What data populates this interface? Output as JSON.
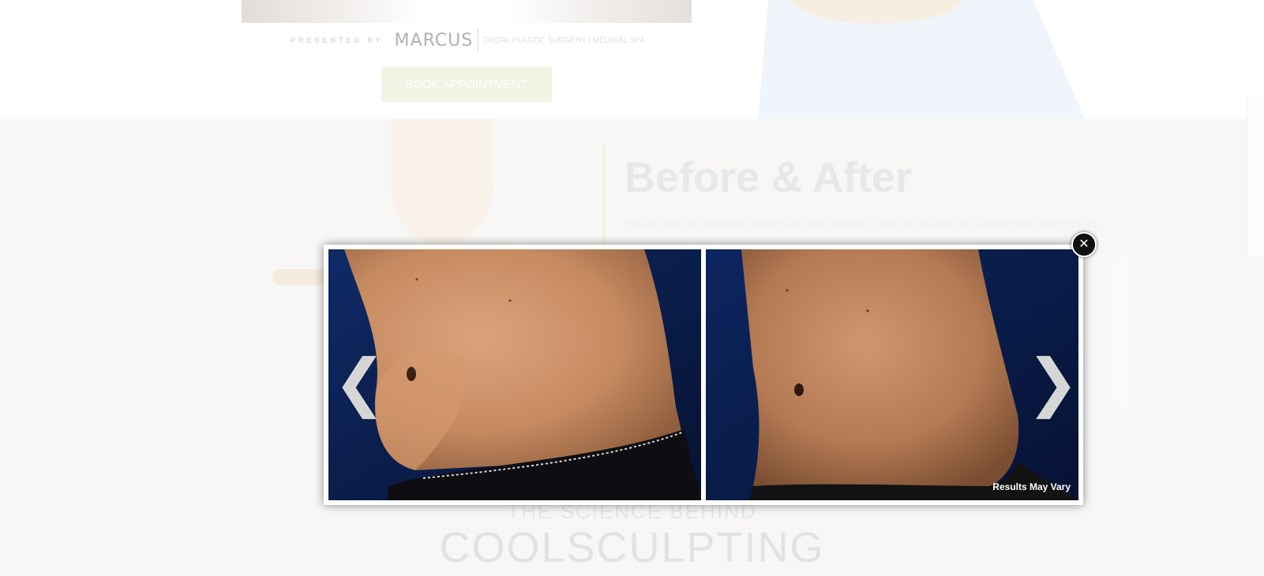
{
  "page": {
    "presented_by": "PRESENTED BY",
    "brand_name": "MARCUS",
    "brand_tagline": "FACIAL PLASTIC SURGERY | MEDICAL SPA",
    "book_button_label": "BOOK APPOINTMENT"
  },
  "before_after": {
    "title": "Before & After",
    "description": "Please view our beautiful before and after gallery to see for yourself the smooth and clear results"
  },
  "science": {
    "line1": "THE SCIENCE BEHIND",
    "line2": "COOLSCULPTING"
  },
  "lightbox": {
    "results_label": "Results May Vary",
    "prev_arrow_glyph": "❮",
    "next_arrow_glyph": "❯",
    "close_glyph": "✕",
    "before_alt": "Before: abdomen side view",
    "after_alt": "After: abdomen side view"
  },
  "colors": {
    "accent_green": "#c9d08a",
    "photo_backdrop": "#0c1e4a",
    "skin_tone": "#c78f67"
  }
}
